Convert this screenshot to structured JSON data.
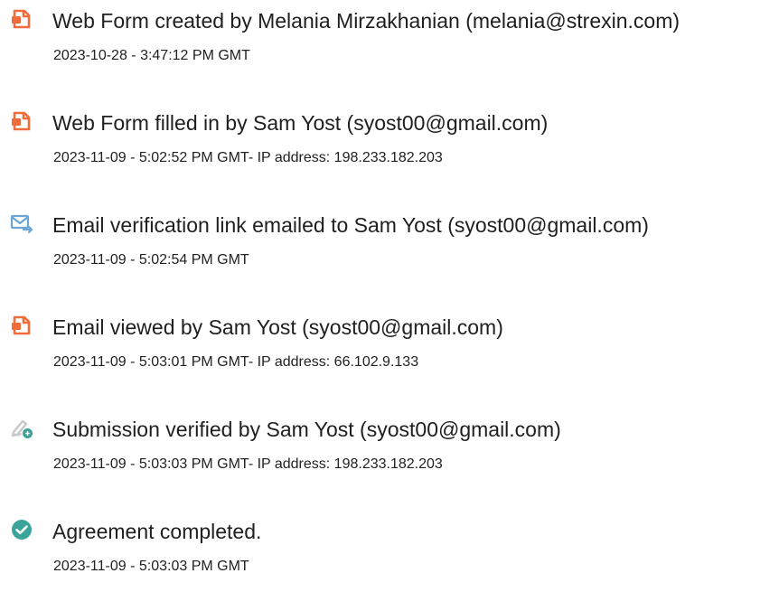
{
  "colors": {
    "doc_icon": "#f26b3a",
    "email_icon": "#6ba6d6",
    "sign_icon_pen": "#c9c9c9",
    "sign_icon_badge": "#3aa39a",
    "check_icon": "#3aa39a",
    "text": "#1f1f1f"
  },
  "events": [
    {
      "icon": "document-icon",
      "title": "Web Form created by Melania Mirzakhanian (melania@strexin.com)",
      "meta": "2023-10-28 - 3:47:12 PM GMT"
    },
    {
      "icon": "document-icon",
      "title": "Web Form filled in by Sam Yost (syost00@gmail.com)",
      "meta": "2023-11-09 - 5:02:52 PM GMT- IP address: 198.233.182.203"
    },
    {
      "icon": "email-forward-icon",
      "title": "Email verification link emailed to Sam Yost (syost00@gmail.com)",
      "meta": "2023-11-09 - 5:02:54 PM GMT"
    },
    {
      "icon": "document-icon",
      "title": "Email viewed by Sam Yost (syost00@gmail.com)",
      "meta": "2023-11-09 - 5:03:01 PM GMT- IP address: 66.102.9.133"
    },
    {
      "icon": "signature-pen-icon",
      "title": "Submission verified by Sam Yost (syost00@gmail.com)",
      "meta": "2023-11-09 - 5:03:03 PM GMT- IP address: 198.233.182.203"
    },
    {
      "icon": "check-circle-icon",
      "title": "Agreement completed.",
      "meta": "2023-11-09 - 5:03:03 PM GMT"
    }
  ]
}
